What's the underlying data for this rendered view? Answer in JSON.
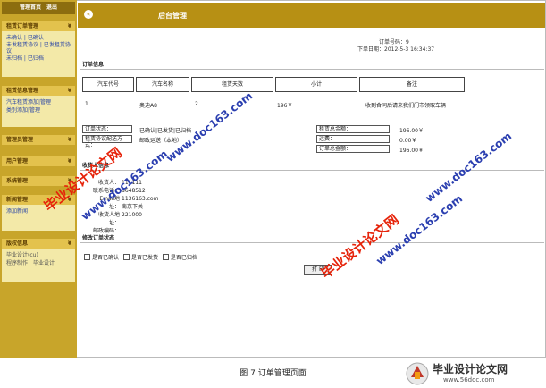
{
  "sidebar": {
    "top_links": "管理首页　退出",
    "rental_orders": {
      "title": "租赁订单管理",
      "items": [
        "未确认 | 已确认",
        "未发租赁协议 | 已发租赁协议",
        "未归档 | 已归档"
      ]
    },
    "rental_info": {
      "title": "租赁信息管理",
      "items": [
        "汽车租赁添加|管理",
        "类别添加|管理"
      ]
    },
    "vehicle_mgmt": "管理员管理",
    "user_mgmt": "用户管理",
    "system_mgmt": "系统管理",
    "news_mgmt": {
      "title": "新闻管理",
      "items": [
        "添加新闻"
      ]
    },
    "version_info": {
      "title": "版权信息",
      "items": [
        "毕业设计(cu)",
        "程序制作：毕业设计"
      ]
    }
  },
  "header": {
    "title": "后台管理"
  },
  "order": {
    "number": "订单号码：9",
    "date": "下单日期：2012-5-3 16:34:37"
  },
  "order_info": {
    "title": "订单信息",
    "columns": [
      "汽车代号",
      "汽车名称",
      "租赁天数",
      "小计",
      "备注"
    ],
    "row": [
      "1",
      "奥迪A8",
      "2",
      "196￥",
      "收到合同后请来我们门市领取车辆"
    ]
  },
  "status": {
    "order_status_label": "订单状态：",
    "order_status_value": "已确认|已发货|已归档",
    "delivery_label": "租赁协议配送方式：",
    "delivery_value": "邮政运送（本地）",
    "rent_total_label": "租赁总金额：",
    "rent_total_value": "196.00￥",
    "freight_label": "运费：",
    "freight_value": "0.00￥",
    "order_total_label": "订单总金额：",
    "order_total_value": "196.00￥"
  },
  "receiver": {
    "title": "收货人信息",
    "rows": [
      {
        "label": "收货人：",
        "value": "111111"
      },
      {
        "label": "联系电话：",
        "value": "8648512"
      },
      {
        "label": "Email地址：",
        "value": "1136163.com"
      },
      {
        "label": "收货人地址：",
        "value": "南京下关"
      },
      {
        "label": "邮政编码：",
        "value": "221000"
      }
    ]
  },
  "modify": {
    "title": "修改订单状态",
    "checkboxes": [
      "是否已确认",
      "是否已发货",
      "是否已归档"
    ],
    "print_label": "打 印"
  },
  "watermarks": {
    "red": "毕业设计论文网",
    "blue": "www.doc163.com"
  },
  "caption": "图 7 订单管理页面",
  "logo": {
    "title": "毕业设计论文网",
    "url": "www.56doc.com"
  }
}
